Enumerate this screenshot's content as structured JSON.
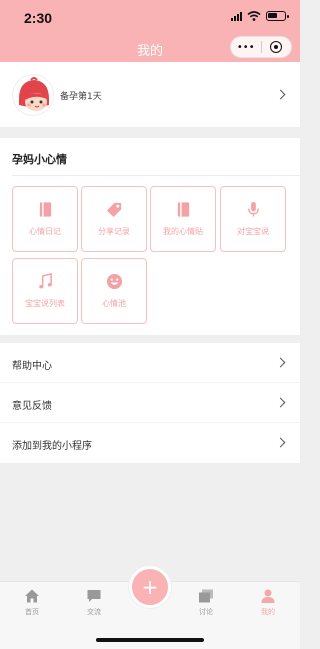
{
  "status_bar": {
    "time": "2:30"
  },
  "header": {
    "title": "我的",
    "capsule_more": "•••"
  },
  "profile": {
    "text": "备孕第1天"
  },
  "mood": {
    "title": "孕妈小心情",
    "tiles": [
      {
        "label": "心情日记",
        "icon": "book-icon"
      },
      {
        "label": "分享记录",
        "icon": "tag-icon"
      },
      {
        "label": "我的心情贴",
        "icon": "book-icon"
      },
      {
        "label": "对宝宝说",
        "icon": "microphone-icon"
      },
      {
        "label": "宝宝说列表",
        "icon": "music-note-icon"
      },
      {
        "label": "心情池",
        "icon": "smiley-icon"
      }
    ]
  },
  "menu": [
    {
      "label": "帮助中心"
    },
    {
      "label": "意见反馈"
    },
    {
      "label": "添加到我的小程序"
    }
  ],
  "tabbar": {
    "tabs": [
      {
        "label": "首页",
        "icon": "home-icon"
      },
      {
        "label": "交流",
        "icon": "chat-icon"
      },
      {
        "label": "讨论",
        "icon": "stack-icon"
      },
      {
        "label": "我的",
        "icon": "user-icon"
      }
    ],
    "fab": "+"
  },
  "colors": {
    "accent": "#f9b3b4",
    "tile_border": "#f6c2c2",
    "tile_text": "#f3a3a5"
  }
}
